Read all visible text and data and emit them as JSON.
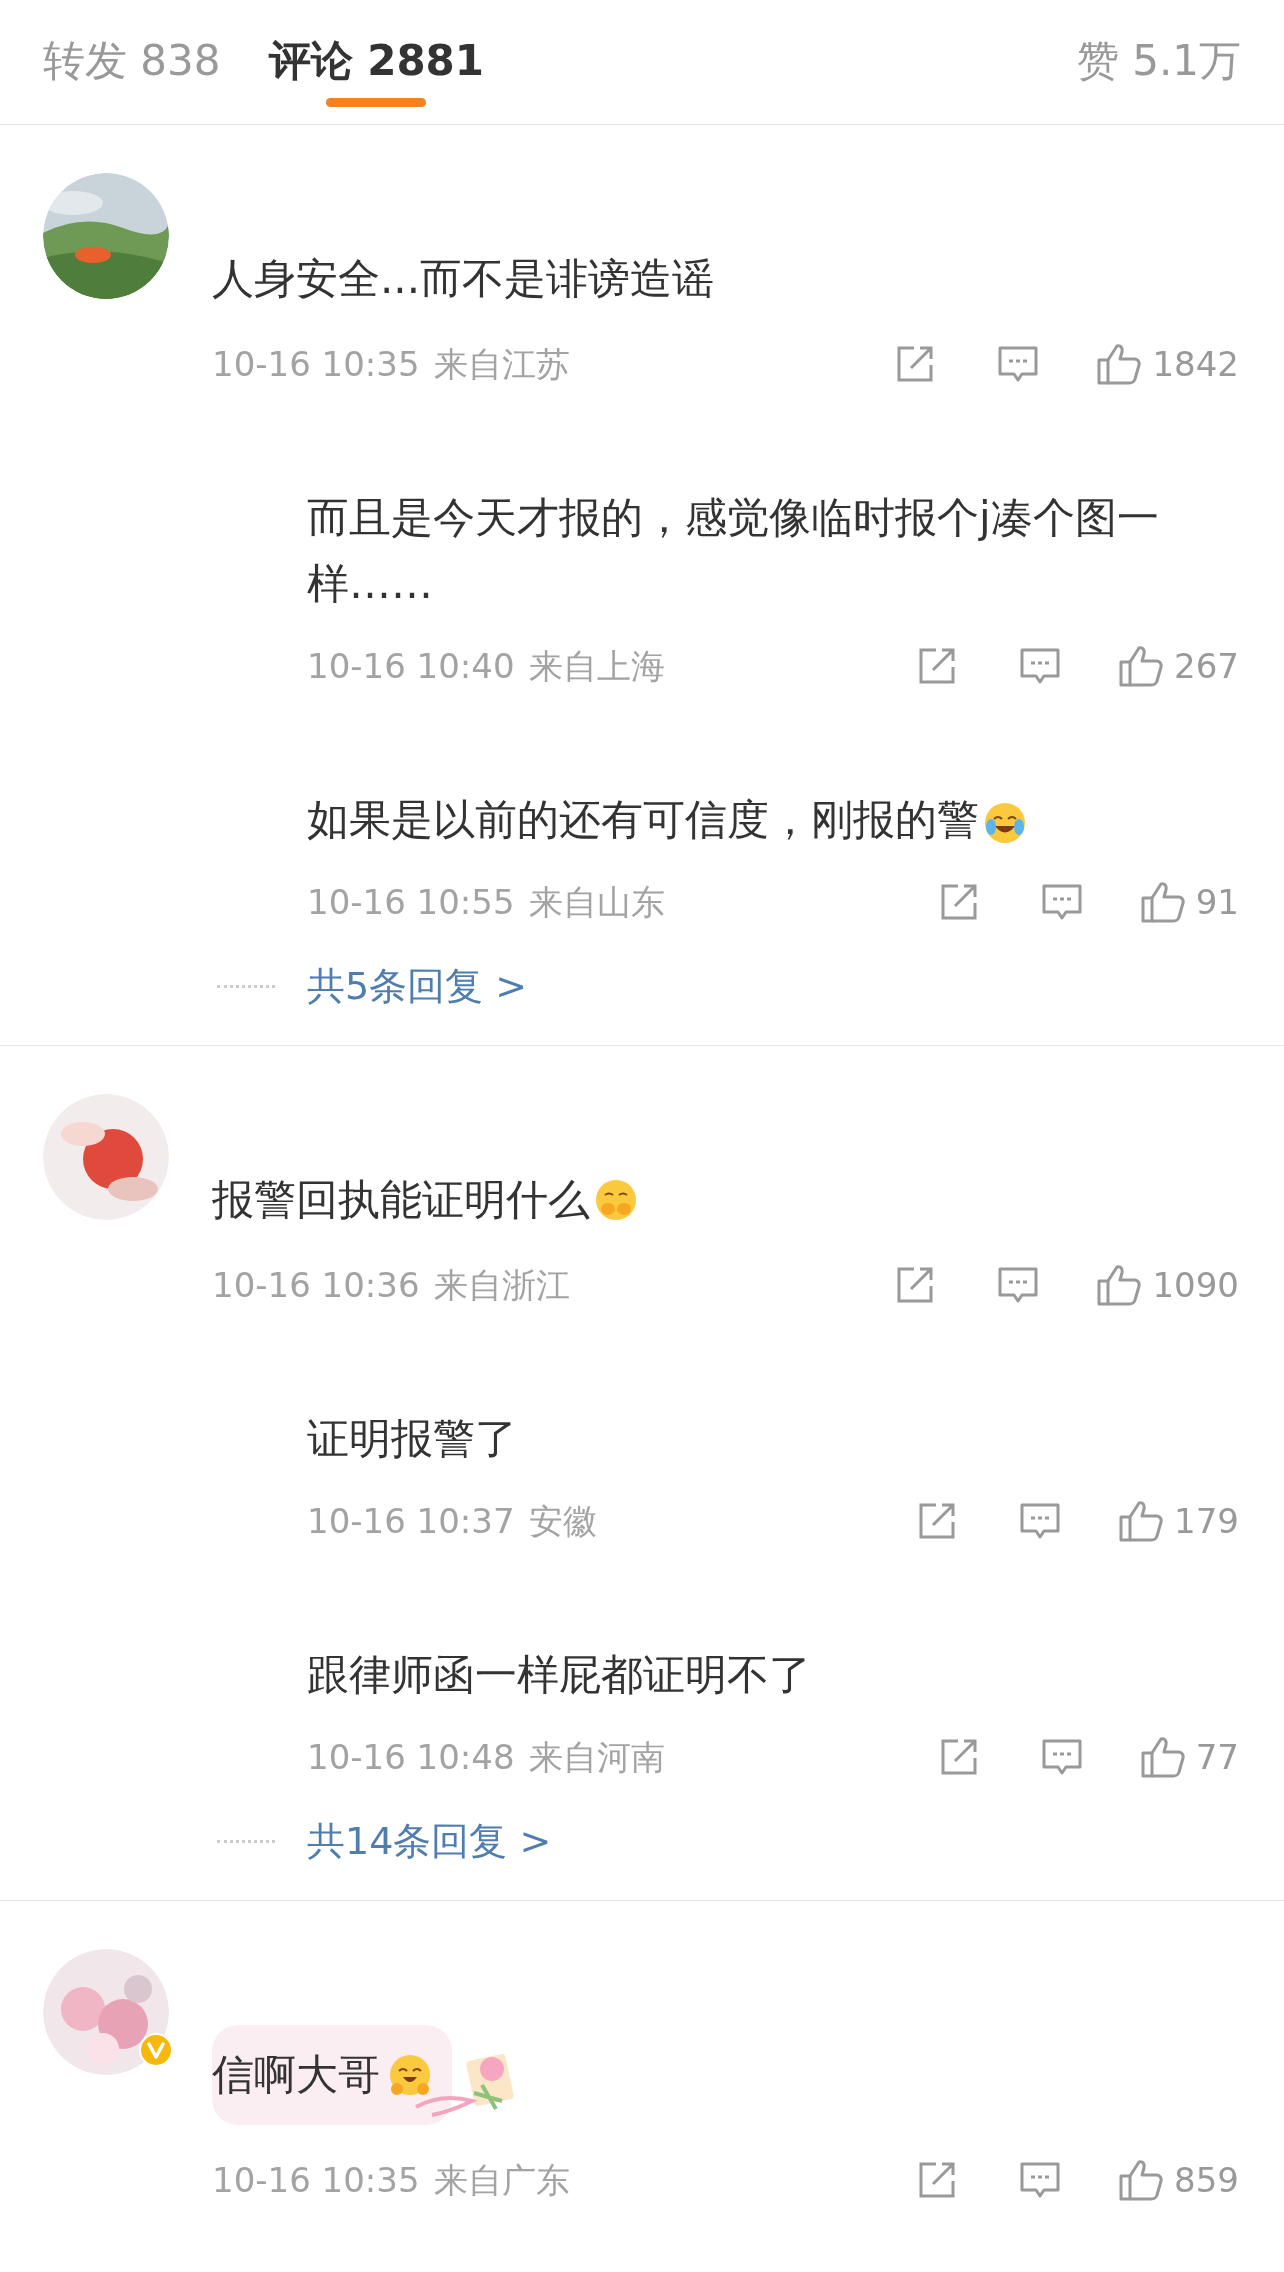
{
  "tabs": [
    {
      "label": "转发",
      "count": "838",
      "selected": false
    },
    {
      "label": "评论",
      "count": "2881",
      "selected": true
    }
  ],
  "likes_tab": {
    "label": "赞",
    "count": "5.1万"
  },
  "comments": [
    {
      "avatar": {
        "kind": "picture"
      },
      "verified": false,
      "decorated": false,
      "text": "人身安全...而不是诽谤造谣",
      "time": "10-16 10:35",
      "location": "来自江苏",
      "likes": "1842",
      "replies": [
        {
          "text": "而且是今天才报的，感觉像临时报个j凑个图一样……",
          "time": "10-16 10:40",
          "location": "来自上海",
          "likes": "267"
        },
        {
          "text": "如果是以前的还有可信度，刚报的警",
          "emoji": {
            "kind": "laugh"
          },
          "time": "10-16 10:55",
          "location": "来自山东",
          "likes": "91"
        }
      ],
      "more_replies": "共5条回复 >"
    },
    {
      "avatar": {
        "kind": "picture"
      },
      "verified": false,
      "decorated": false,
      "text": "报警回执能证明什么",
      "emoji": {
        "kind": "cover"
      },
      "time": "10-16 10:36",
      "location": "来自浙江",
      "likes": "1090",
      "replies": [
        {
          "text": "证明报警了",
          "time": "10-16 10:37",
          "location": "安徽",
          "likes": "179"
        },
        {
          "text": "跟律师函一样屁都证明不了",
          "time": "10-16 10:48",
          "location": "来自河南",
          "likes": "77"
        }
      ],
      "more_replies": "共14条回复 >"
    },
    {
      "avatar": {
        "kind": "picture"
      },
      "verified": true,
      "decorated": true,
      "text": "信啊大哥",
      "emoji": {
        "kind": "hug"
      },
      "time": "10-16 10:35",
      "location": "来自广东",
      "likes": "859"
    }
  ]
}
